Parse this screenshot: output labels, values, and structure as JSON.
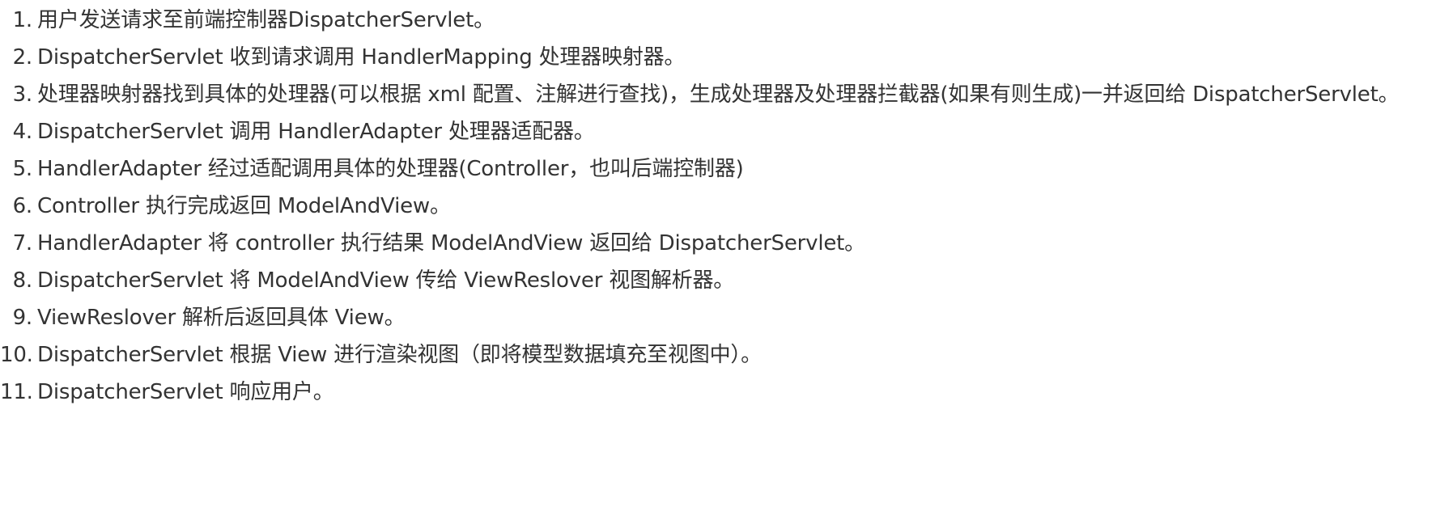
{
  "steps": [
    {
      "num": "1.",
      "text": "用户发送请求至前端控制器DispatcherServlet。"
    },
    {
      "num": "2.",
      "text": "DispatcherServlet 收到请求调用 HandlerMapping 处理器映射器。"
    },
    {
      "num": "3.",
      "text": "处理器映射器找到具体的处理器(可以根据 xml 配置、注解进行查找)，生成处理器及处理器拦截器(如果有则生成)一并返回给 DispatcherServlet。"
    },
    {
      "num": "4.",
      "text": "DispatcherServlet 调用 HandlerAdapter 处理器适配器。"
    },
    {
      "num": "5.",
      "text": "HandlerAdapter 经过适配调用具体的处理器(Controller，也叫后端控制器)"
    },
    {
      "num": "6.",
      "text": "Controller 执行完成返回 ModelAndView。"
    },
    {
      "num": "7.",
      "text": "HandlerAdapter 将 controller 执行结果 ModelAndView 返回给 DispatcherServlet。"
    },
    {
      "num": "8.",
      "text": "DispatcherServlet 将 ModelAndView 传给 ViewReslover 视图解析器。"
    },
    {
      "num": "9.",
      "text": "ViewReslover 解析后返回具体 View。"
    },
    {
      "num": "10.",
      "text": "DispatcherServlet 根据 View 进行渲染视图（即将模型数据填充至视图中）。"
    },
    {
      "num": "11.",
      "text": "DispatcherServlet 响应用户。"
    }
  ]
}
